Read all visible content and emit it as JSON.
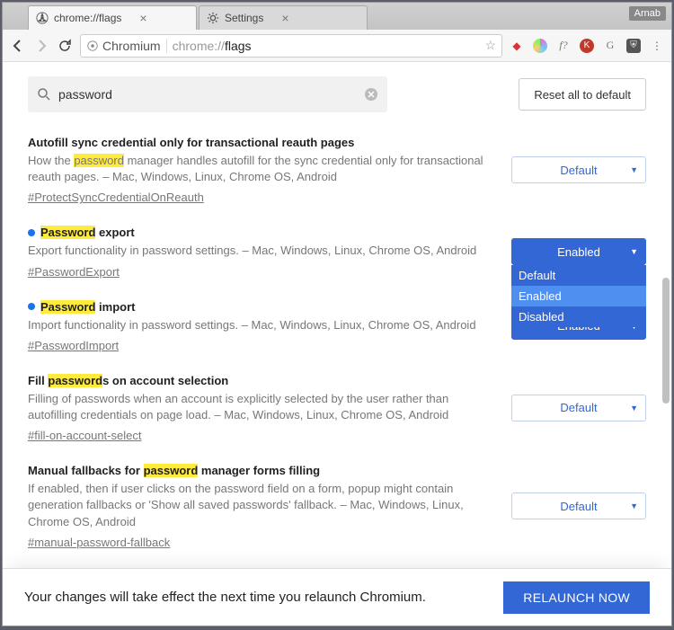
{
  "window": {
    "user_badge": "Arnab",
    "tabs": [
      {
        "title": "chrome://flags",
        "active": true
      },
      {
        "title": "Settings",
        "active": false
      }
    ],
    "omnibox_chip": "Chromium",
    "omnibox_prefix": "chrome://",
    "omnibox_path": "flags"
  },
  "header": {
    "search_value": "password",
    "reset_label": "Reset all to default"
  },
  "dropdown_options": [
    "Default",
    "Enabled",
    "Disabled"
  ],
  "flags": [
    {
      "title_pre": "Autofill sync credential only for transactional reauth pages",
      "title_hl": "",
      "title_post": "",
      "desc_pre": "How the ",
      "desc_hl": "password",
      "desc_post": " manager handles autofill for the sync credential only for transactional reauth pages. – Mac, Windows, Linux, Chrome OS, Android",
      "link": "#ProtectSyncCredentialOnReauth",
      "selected": "Default",
      "style": "default",
      "dot": false
    },
    {
      "title_pre": "",
      "title_hl": "Password",
      "title_post": " export",
      "desc_pre": "Export functionality in password settings. – Mac, Windows, Linux, Chrome OS, Android",
      "desc_hl": "",
      "desc_post": "",
      "link": "#PasswordExport",
      "selected": "Enabled",
      "style": "enabled",
      "dot": true,
      "open_dropdown": true
    },
    {
      "title_pre": "",
      "title_hl": "Password",
      "title_post": " import",
      "desc_pre": "Import functionality in password settings. – Mac, Windows, Linux, Chrome OS, Android",
      "desc_hl": "",
      "desc_post": "",
      "link": "#PasswordImport",
      "selected": "Enabled",
      "style": "enabled",
      "dot": true
    },
    {
      "title_pre": "Fill ",
      "title_hl": "password",
      "title_post": "s on account selection",
      "desc_pre": "Filling of passwords when an account is explicitly selected by the user rather than autofilling credentials on page load. – Mac, Windows, Linux, Chrome OS, Android",
      "desc_hl": "",
      "desc_post": "",
      "link": "#fill-on-account-select",
      "selected": "Default",
      "style": "default",
      "dot": false
    },
    {
      "title_pre": "Manual fallbacks for ",
      "title_hl": "password",
      "title_post": " manager forms filling",
      "desc_pre": "If enabled, then if user clicks on the password field on a form, popup might contain generation fallbacks or 'Show all saved passwords' fallback. – Mac, Windows, Linux, Chrome OS, Android",
      "desc_hl": "",
      "desc_post": "",
      "link": "#manual-password-fallback",
      "selected": "Default",
      "style": "default",
      "dot": false
    }
  ],
  "footer": {
    "msg": "Your changes will take effect the next time you relaunch Chromium.",
    "button": "RELAUNCH NOW"
  }
}
